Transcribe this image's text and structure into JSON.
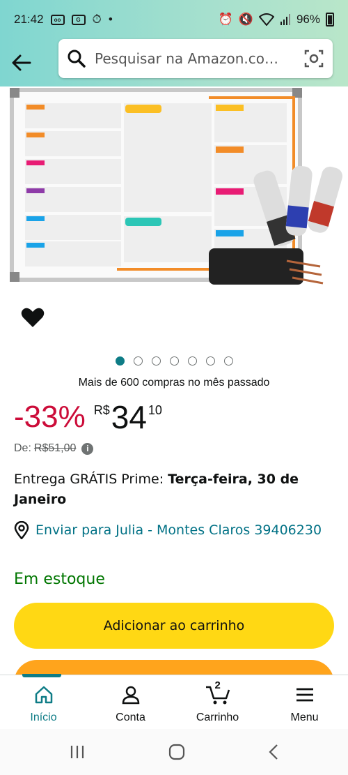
{
  "status_bar": {
    "time": "21:42",
    "battery": "96%"
  },
  "search": {
    "placeholder": "Pesquisar na Amazon.co…"
  },
  "image_carousel": {
    "total_dots": 7,
    "active_index": 0
  },
  "product": {
    "bought_text": "Mais de 600 compras no mês passado",
    "discount": "-33%",
    "currency": "R$",
    "price_whole": "34",
    "price_fraction": "10",
    "was_label": "De:",
    "was_price": "R$51,00"
  },
  "delivery": {
    "prefix": "Entrega GRÁTIS Prime:",
    "date": "Terça-feira, 30 de Janeiro"
  },
  "ship_to": "Enviar para Julia - Montes Claros 39406230",
  "stock": "Em estoque",
  "buttons": {
    "add_to_cart": "Adicionar ao carrinho"
  },
  "bottom_nav": {
    "items": [
      {
        "label": "Início",
        "icon": "home-icon"
      },
      {
        "label": "Conta",
        "icon": "account-icon"
      },
      {
        "label": "Carrinho",
        "icon": "cart-icon",
        "count": "2"
      },
      {
        "label": "Menu",
        "icon": "menu-icon"
      }
    ]
  },
  "colors": {
    "accent": "#0e7c86",
    "discount": "#cc0c39",
    "add_to_cart": "#ffd814",
    "buy_now": "#ffa41c",
    "in_stock": "#007600",
    "link": "#007185"
  }
}
